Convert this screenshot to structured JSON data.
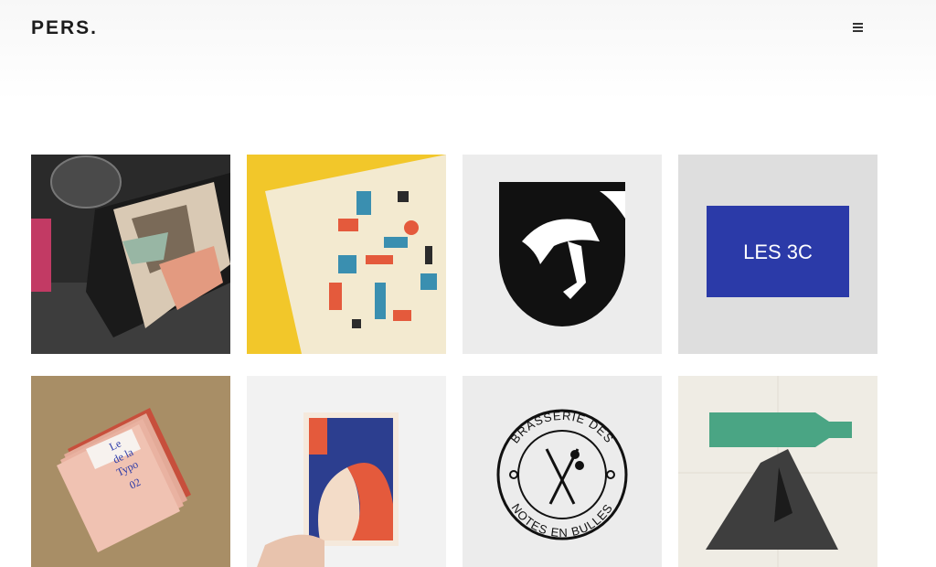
{
  "header": {
    "logo_text": "PERS.",
    "menu_icon": "hamburger-icon"
  },
  "projects": [
    {
      "name": "wine-bottle-collage"
    },
    {
      "name": "illustrated-book"
    },
    {
      "name": "horse-shield-logo"
    },
    {
      "name": "les-3c-card",
      "text": "LES 3C"
    },
    {
      "name": "typo-booklets",
      "text_lines": [
        "Le",
        "de la",
        "Typo",
        "02"
      ]
    },
    {
      "name": "kiss-illustration-card"
    },
    {
      "name": "brasserie-logo",
      "text_top": "BRASSERIE DES",
      "text_bottom": "NOTES EN BULLES"
    },
    {
      "name": "bottle-mountain-print"
    }
  ],
  "colors": {
    "blue_card": "#2b3aa8",
    "shield": "#111111",
    "accent_red": "#e45a3c",
    "paper_green": "#4aa584"
  }
}
